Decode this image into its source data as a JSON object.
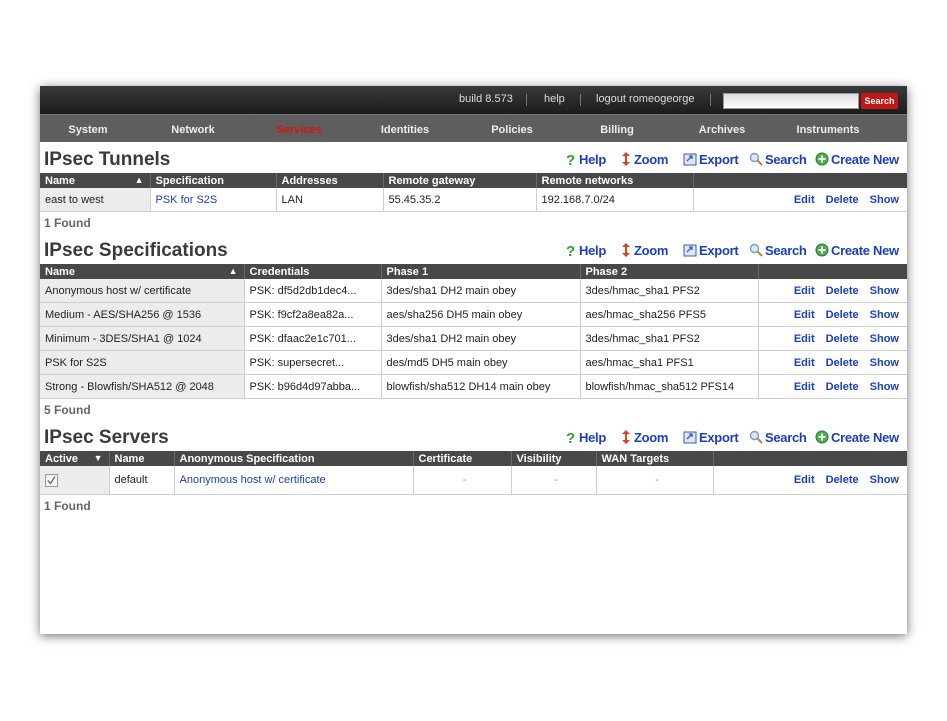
{
  "topbar": {
    "build": "build 8.573",
    "help": "help",
    "logout": "logout romeogeorge",
    "search_placeholder": "",
    "search_button": "Search"
  },
  "nav": [
    "System",
    "Network",
    "Services",
    "Identities",
    "Policies",
    "Billing",
    "Archives",
    "Instruments"
  ],
  "active_nav": "Services",
  "toolbar": {
    "help": "Help",
    "zoom": "Zoom",
    "export": "Export",
    "search": "Search",
    "create": "Create New"
  },
  "row_actions": {
    "edit": "Edit",
    "delete": "Delete",
    "show": "Show"
  },
  "tunnels": {
    "title": "IPsec Tunnels",
    "columns": [
      "Name",
      "Specification",
      "Addresses",
      "Remote gateway",
      "Remote networks"
    ],
    "rows": [
      {
        "name": "east to west",
        "spec": "PSK for S2S",
        "addr": "LAN",
        "gateway": "55.45.35.2",
        "networks": "192.168.7.0/24"
      }
    ],
    "found": "1 Found"
  },
  "specs": {
    "title": "IPsec Specifications",
    "columns": [
      "Name",
      "Credentials",
      "Phase 1",
      "Phase 2"
    ],
    "rows": [
      {
        "name": "Anonymous host w/ certificate",
        "cred": "PSK: df5d2db1dec4...",
        "p1": "3des/sha1 DH2 main obey",
        "p2": "3des/hmac_sha1 PFS2"
      },
      {
        "name": "Medium - AES/SHA256 @ 1536",
        "cred": "PSK: f9cf2a8ea82a...",
        "p1": "aes/sha256 DH5 main obey",
        "p2": "aes/hmac_sha256 PFS5"
      },
      {
        "name": "Minimum - 3DES/SHA1 @ 1024",
        "cred": "PSK: dfaac2e1c701...",
        "p1": "3des/sha1 DH2 main obey",
        "p2": "3des/hmac_sha1 PFS2"
      },
      {
        "name": "PSK for S2S",
        "cred": "PSK: supersecret...",
        "p1": "des/md5 DH5 main obey",
        "p2": "aes/hmac_sha1 PFS1"
      },
      {
        "name": "Strong - Blowfish/SHA512 @ 2048",
        "cred": "PSK: b96d4d97abba...",
        "p1": "blowfish/sha512 DH14 main obey",
        "p2": "blowfish/hmac_sha512 PFS14"
      }
    ],
    "found": "5 Found"
  },
  "servers": {
    "title": "IPsec Servers",
    "columns": [
      "Active",
      "Name",
      "Anonymous Specification",
      "Certificate",
      "Visibility",
      "WAN Targets"
    ],
    "rows": [
      {
        "name": "default",
        "spec": "Anonymous host w/ certificate",
        "cert": "-",
        "vis": "-",
        "wan": "-"
      }
    ],
    "found": "1 Found"
  },
  "colors": {
    "accent": "#1a3fc0",
    "active_nav": "#dd1111",
    "search_button": "#c31717",
    "header_bg": "#484848"
  }
}
